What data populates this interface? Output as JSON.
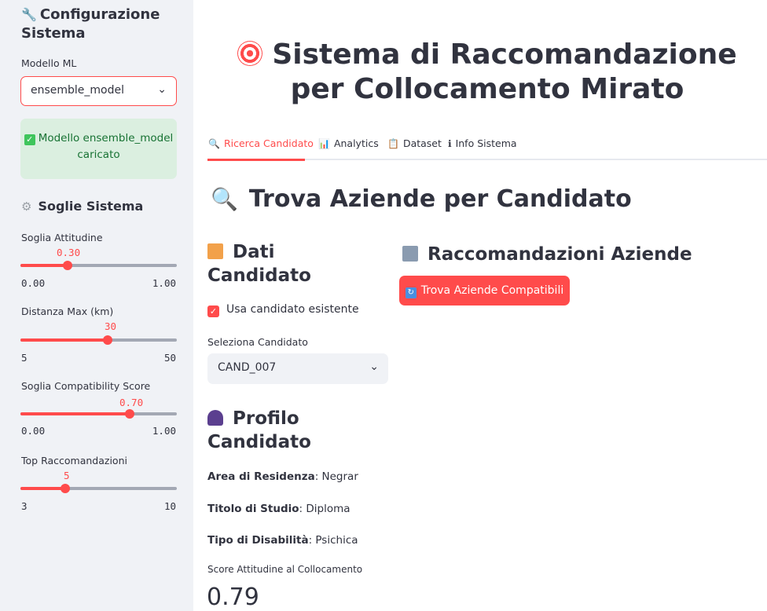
{
  "sidebar": {
    "config_title": "Configurazione Sistema",
    "model_label": "Modello ML",
    "model_value": "ensemble_model",
    "success_msg": "Modello ensemble_model caricato",
    "thresholds_title": "Soglie Sistema",
    "sliders": [
      {
        "label": "Soglia Attitudine",
        "value": "0.30",
        "min": "0.00",
        "max": "1.00",
        "fraction": 0.3
      },
      {
        "label": "Distanza Max (km)",
        "value": "30",
        "min": "5",
        "max": "50",
        "fraction": 0.5556
      },
      {
        "label": "Soglia Compatibility Score",
        "value": "0.70",
        "min": "0.00",
        "max": "1.00",
        "fraction": 0.7
      },
      {
        "label": "Top Raccomandazioni",
        "value": "5",
        "min": "3",
        "max": "10",
        "fraction": 0.2857
      }
    ]
  },
  "main": {
    "title": "Sistema di Raccomandazione per Collocamento Mirato",
    "tabs": [
      {
        "label": "Ricerca Candidato",
        "icon": "magnifier-icon"
      },
      {
        "label": "Analytics",
        "icon": "bar-chart-icon"
      },
      {
        "label": "Dataset",
        "icon": "clipboard-icon"
      },
      {
        "label": "Info Sistema",
        "icon": "info-icon"
      }
    ],
    "section_title": "Trova Aziende per Candidato",
    "dati_title": "Dati Candidato",
    "use_existing_label": "Usa candidato esistente",
    "select_candidate_label": "Seleziona Candidato",
    "select_candidate_value": "CAND_007",
    "profile_title": "Profilo Candidato",
    "profile": [
      {
        "key": "Area di Residenza",
        "value": "Negrar"
      },
      {
        "key": "Titolo di Studio",
        "value": "Diploma"
      },
      {
        "key": "Tipo di Disabilità",
        "value": "Psichica"
      }
    ],
    "score_label": "Score Attitudine al Collocamento",
    "score_value": "0.79",
    "recommend_title": "Raccomandazioni Aziende",
    "find_button": "Trova Aziende Compatibili"
  },
  "colors": {
    "accent": "#ff4b4b",
    "sidebar_bg": "#f0f2f6",
    "success_bg": "#dbefe0",
    "success_text": "#177233"
  }
}
